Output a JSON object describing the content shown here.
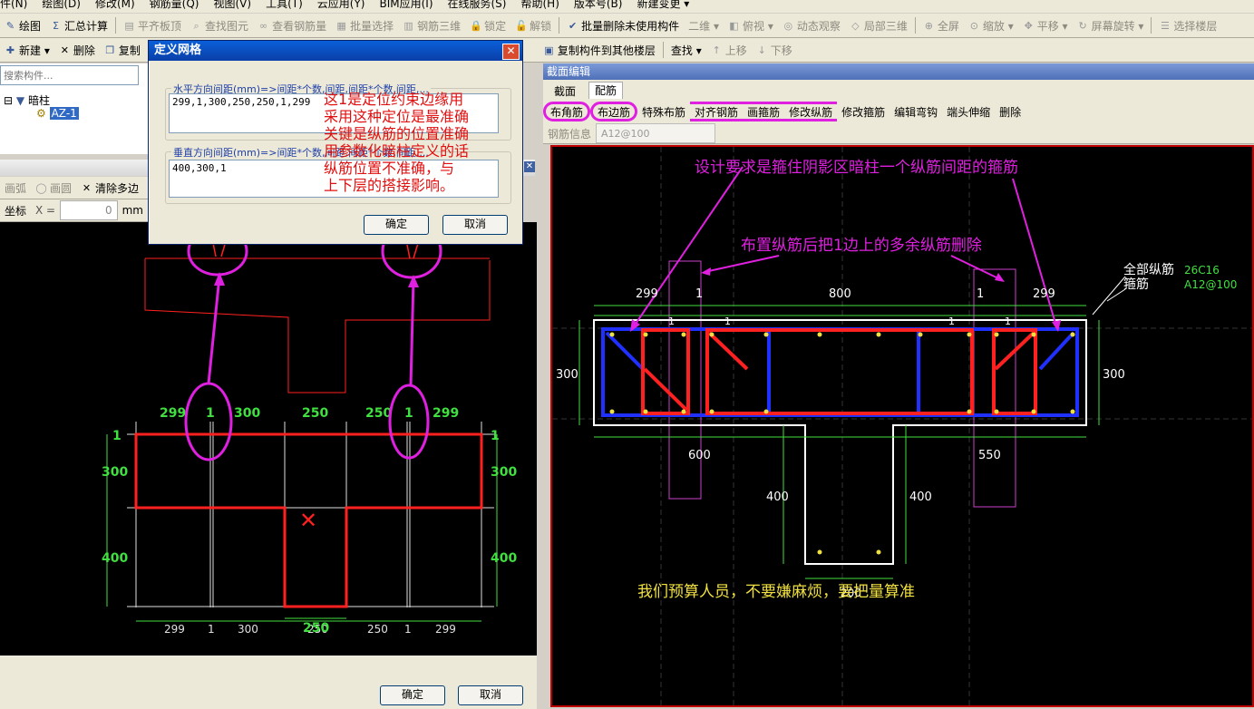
{
  "menubar": [
    "件(N)",
    "绘图(D)",
    "修改(M)",
    "钢筋量(Q)",
    "视图(V)",
    "工具(T)",
    "云应用(Y)",
    "BIM应用(I)",
    "在线服务(S)",
    "帮助(H)",
    "版本号(B)",
    "新建变更 ▾"
  ],
  "toolbar1": {
    "items": [
      {
        "label": "绘图",
        "icon": "✎",
        "dis": false
      },
      {
        "label": "汇总计算",
        "icon": "Σ",
        "dis": false
      },
      {
        "label": "平齐板顶",
        "icon": "▤",
        "dis": true
      },
      {
        "label": "查找图元",
        "icon": "⌕",
        "dis": true
      },
      {
        "label": "查看钢筋量",
        "icon": "∞",
        "dis": true
      },
      {
        "label": "批量选择",
        "icon": "▦",
        "dis": true
      },
      {
        "label": "钢筋三维",
        "icon": "▥",
        "dis": true
      },
      {
        "label": "锁定",
        "icon": "🔒",
        "dis": true
      },
      {
        "label": "解锁",
        "icon": "🔓",
        "dis": true
      },
      {
        "label": "批量删除未使用构件",
        "icon": "✔",
        "dis": false
      },
      {
        "label": "二维 ▾",
        "icon": "",
        "dis": true
      },
      {
        "label": "俯视 ▾",
        "icon": "◧",
        "dis": true
      },
      {
        "label": "动态观察",
        "icon": "◎",
        "dis": true
      },
      {
        "label": "局部三维",
        "icon": "◇",
        "dis": true
      },
      {
        "label": "全屏",
        "icon": "⊕",
        "dis": true
      },
      {
        "label": "缩放 ▾",
        "icon": "⊙",
        "dis": true
      },
      {
        "label": "平移 ▾",
        "icon": "✥",
        "dis": true
      },
      {
        "label": "屏幕旋转 ▾",
        "icon": "↻",
        "dis": true
      },
      {
        "label": "选择楼层",
        "icon": "☰",
        "dis": true
      }
    ]
  },
  "toolbar2": {
    "new_label": "新建 ▾",
    "delete_label": "删除",
    "copy_label": "复制",
    "copy_other_floor": "复制构件到其他楼层",
    "find_label": "查找 ▾",
    "up_label": "上移",
    "down_label": "下移"
  },
  "left": {
    "search_placeholder": "搜索构件...",
    "tree_root": "暗柱",
    "tree_child": "AZ-1",
    "draw_tb": {
      "arc": "画弧",
      "circle": "画圆",
      "clear": "清除多边"
    },
    "coord_label": "坐标",
    "x_label": "X =",
    "x_value": "0",
    "mm": "mm",
    "ok": "确定",
    "cancel": "取消"
  },
  "dialog": {
    "title": "定义网格",
    "h_label": "水平方向间距(mm)=>间距*个数,间距,间距*个数,间距,...",
    "h_value": "299,1,300,250,250,1,299",
    "v_label": "垂直方向间距(mm)=>间距*个数,间距,间距*个数,间距,...",
    "v_value": "400,300,1",
    "ok": "确定",
    "cancel": "取消"
  },
  "note_red": [
    "这1是定位约束边缘用",
    "采用这种定位是最准确",
    "关键是纵筋的位置准确",
    "用参数化暗柱定义的话",
    "纵筋位置不准确，与",
    "上下层的搭接影响。"
  ],
  "grid": {
    "top_dims": [
      "299",
      "1",
      "300",
      "250",
      "250",
      "1",
      "299"
    ],
    "bottom_dims": [
      "299",
      "1",
      "300",
      "250",
      "250",
      "1",
      "299"
    ],
    "left_dims": [
      "1",
      "300",
      "400"
    ],
    "right_dims": [
      "1",
      "300",
      "400"
    ],
    "bottom_mid": "250"
  },
  "right": {
    "title": "截面编辑",
    "tabs": [
      "截面",
      "配筋"
    ],
    "tools": [
      "布角筋",
      "布边筋",
      "特殊布筋",
      "对齐钢筋",
      "画箍筋",
      "修改纵筋",
      "修改箍筋",
      "编辑弯钩",
      "端头伸缩",
      "删除"
    ],
    "rebar_info_label": "钢筋信息",
    "rebar_info_value": "A12@100",
    "note_top": "设计要求是箍住阴影区暗柱一个纵筋间距的箍筋",
    "note_mid": "布置纵筋后把1边上的多余纵筋删除",
    "all_rebar_label": "全部纵筋",
    "all_rebar_value": "26C16",
    "stirrup_label": "箍筋",
    "stirrup_value": "A12@100",
    "dims": {
      "t1": "299",
      "t2": "1",
      "t3": "800",
      "t4": "1",
      "t5": "299",
      "s1": "1",
      "s2": "1",
      "s3": "1",
      "s4": "1",
      "l300": "300",
      "r300": "300",
      "b600": "600",
      "b550": "550",
      "l400": "400",
      "r400": "400",
      "b200": "200"
    },
    "note_bottom": "我们预算人员，不要嫌麻烦，要把量算准"
  }
}
